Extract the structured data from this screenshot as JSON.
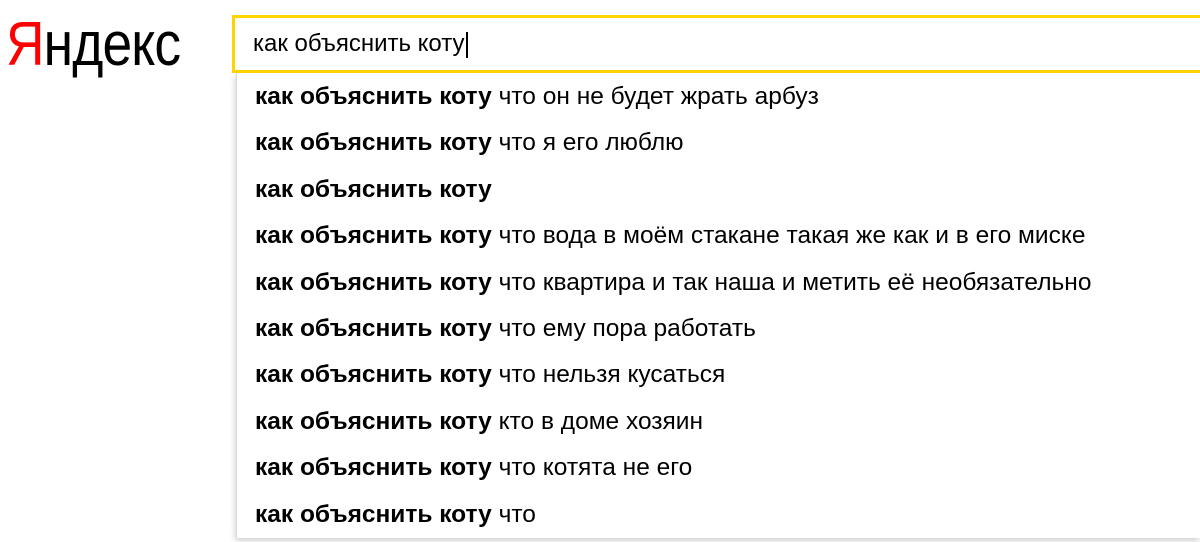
{
  "logo": {
    "first_letter": "Я",
    "rest": "ндекс",
    "accent_color": "#ff0000"
  },
  "search": {
    "value": "как объяснить коту",
    "border_color": "#ffd500"
  },
  "suggestions": [
    {
      "bold": "как объяснить коту",
      "tail": " что он не будет жрать арбуз"
    },
    {
      "bold": "как объяснить коту",
      "tail": " что я его люблю"
    },
    {
      "bold": "как объяснить коту",
      "tail": ""
    },
    {
      "bold": "как объяснить коту",
      "tail": " что вода в моём стакане такая же как и в его миске"
    },
    {
      "bold": "как объяснить коту",
      "tail": " что квартира и так наша и метить её необязательно"
    },
    {
      "bold": "как объяснить коту",
      "tail": " что ему пора работать"
    },
    {
      "bold": "как объяснить коту",
      "tail": " что нельзя кусаться"
    },
    {
      "bold": "как объяснить коту",
      "tail": " кто в доме хозяин"
    },
    {
      "bold": "как объяснить коту",
      "tail": " что котята не его"
    },
    {
      "bold": "как объяснить коту",
      "tail": " что"
    }
  ]
}
